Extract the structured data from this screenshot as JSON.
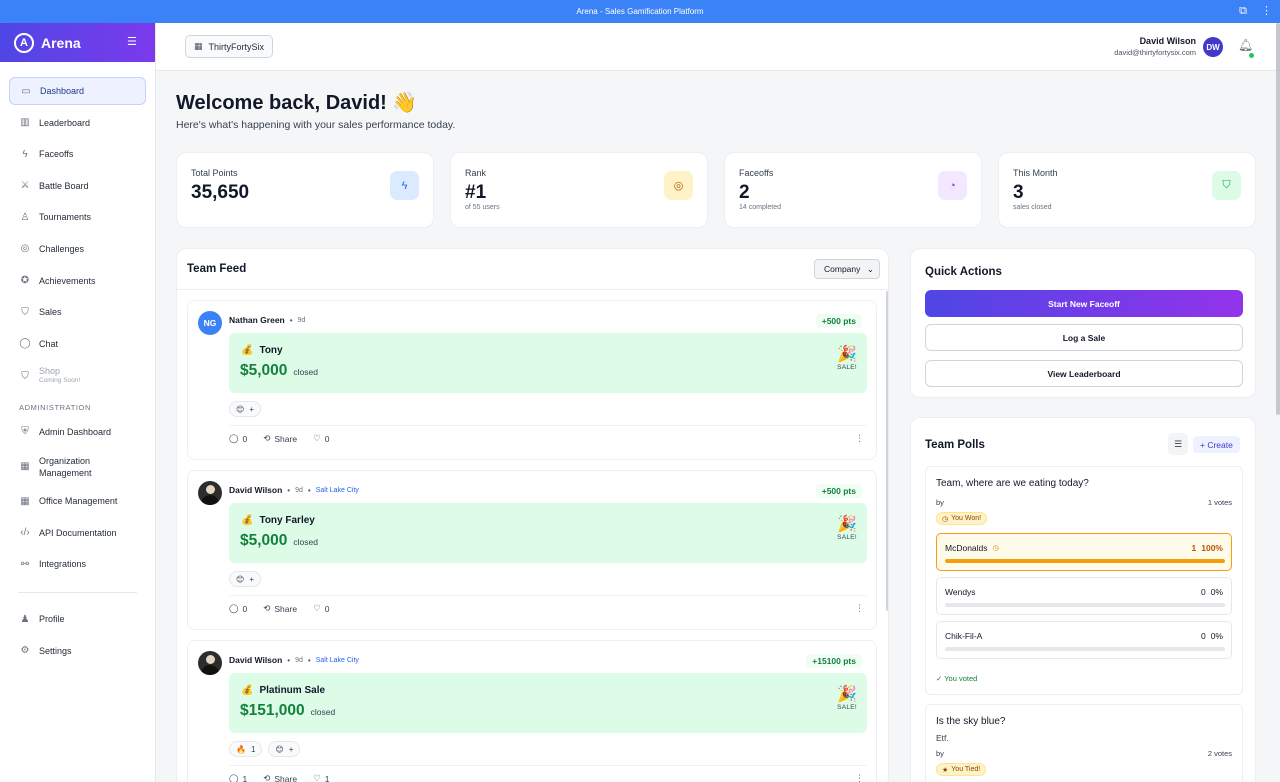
{
  "window": {
    "title": "Arena - Sales Gamification Platform"
  },
  "sidebar": {
    "brand": "Arena",
    "brand_logo_letter": "A",
    "items": [
      {
        "label": "Dashboard",
        "icon": "dashboard-icon"
      },
      {
        "label": "Leaderboard",
        "icon": "bar-chart-icon"
      },
      {
        "label": "Faceoffs",
        "icon": "lightning-icon"
      },
      {
        "label": "Battle Board",
        "icon": "sword-icon"
      },
      {
        "label": "Tournaments",
        "icon": "trophy-icon"
      },
      {
        "label": "Challenges",
        "icon": "target-icon"
      },
      {
        "label": "Achievements",
        "icon": "award-icon"
      },
      {
        "label": "Sales",
        "icon": "shopping-bag-icon"
      },
      {
        "label": "Chat",
        "icon": "chat-icon"
      }
    ],
    "shop": {
      "label": "Shop",
      "sub": "Coming Soon!"
    },
    "admin_heading": "ADMINISTRATION",
    "admin_items": [
      {
        "label": "Admin Dashboard"
      },
      {
        "label_line1": "Organization",
        "label_line2": "Management"
      },
      {
        "label": "Office Management"
      },
      {
        "label": "API Documentation"
      },
      {
        "label": "Integrations"
      }
    ],
    "bottom_items": [
      {
        "label": "Profile"
      },
      {
        "label": "Settings"
      }
    ]
  },
  "header": {
    "org": "ThirtyFortySix",
    "user_name": "David Wilson",
    "user_email": "david@thirtyfortysix.com",
    "user_initials": "DW"
  },
  "main": {
    "welcome": "Welcome back, David! 👋",
    "welcome_sub": "Here's what's happening with your sales performance today.",
    "stats": [
      {
        "label": "Total Points",
        "value": "35,650",
        "sub": "",
        "icon": "lightning-icon",
        "bg": "#dbeafe",
        "fg": "#2563eb"
      },
      {
        "label": "Rank",
        "value": "#1",
        "sub": "of 55 users",
        "icon": "target-icon",
        "bg": "#fef3c7",
        "fg": "#b45309"
      },
      {
        "label": "Faceoffs",
        "value": "2",
        "sub": "14 completed",
        "icon": "timer-icon",
        "bg": "#f3e8ff",
        "fg": "#9333ea"
      },
      {
        "label": "This Month",
        "value": "3",
        "sub": "sales closed",
        "icon": "bag-icon",
        "bg": "#dcfce7",
        "fg": "#16a34a"
      }
    ]
  },
  "feed": {
    "title": "Team Feed",
    "filter": "Company",
    "posts": [
      {
        "author": "Nathan Green",
        "initials": "NG",
        "ago": "9d",
        "location": "",
        "points": "+500 pts",
        "client": "Tony",
        "amount": "$5,000",
        "closed": "closed",
        "badge": "SALE!",
        "reaction_fire_count": "",
        "comments": "0",
        "share": "Share",
        "likes": "0"
      },
      {
        "author": "David Wilson",
        "initials": "",
        "ago": "9d",
        "location": "Salt Lake City",
        "points": "+500 pts",
        "client": "Tony Farley",
        "amount": "$5,000",
        "closed": "closed",
        "badge": "SALE!",
        "reaction_fire_count": "",
        "comments": "0",
        "share": "Share",
        "likes": "0"
      },
      {
        "author": "David Wilson",
        "initials": "",
        "ago": "9d",
        "location": "Salt Lake City",
        "points": "+15100 pts",
        "client": "Platinum Sale",
        "amount": "$151,000",
        "closed": "closed",
        "badge": "SALE!",
        "reaction_fire_count": "1",
        "comments": "1",
        "share": "Share",
        "likes": "1"
      }
    ]
  },
  "quick_actions": {
    "title": "Quick Actions",
    "buttons": [
      "Start New Faceoff",
      "Log a Sale",
      "View Leaderboard"
    ]
  },
  "polls": {
    "title": "Team Polls",
    "create": "+ Create",
    "items": [
      {
        "question": "Team, where are we eating today?",
        "by": "by",
        "votes": "1 votes",
        "badge": "You Won!",
        "options": [
          {
            "name": "McDonalds",
            "count": "1",
            "pct": "100%",
            "fill": 1.0
          },
          {
            "name": "Wendys",
            "count": "0",
            "pct": "0%",
            "fill": 0.0
          },
          {
            "name": "Chik-Fil-A",
            "count": "0",
            "pct": "0%",
            "fill": 0.0
          }
        ],
        "voted": "✓ You voted"
      },
      {
        "question": "Is the sky blue?",
        "sub": "Etf.",
        "by": "by",
        "votes": "2 votes",
        "badge": "You Tied!"
      }
    ]
  }
}
